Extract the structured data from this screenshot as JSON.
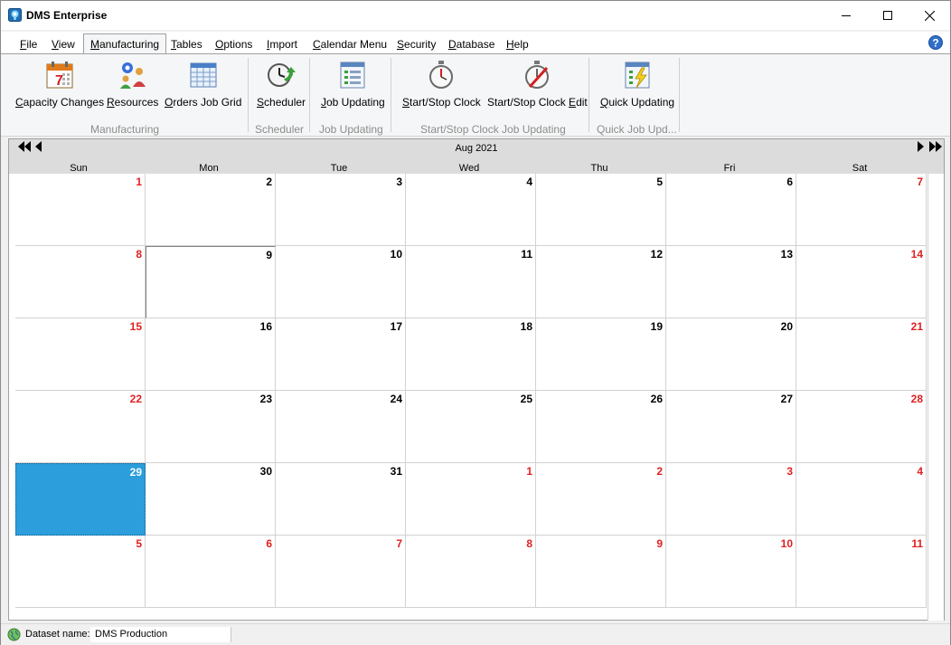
{
  "window": {
    "title": "DMS Enterprise"
  },
  "menu": [
    {
      "label": "File",
      "key": "F",
      "rest": "ile"
    },
    {
      "label": "View",
      "key": "V",
      "rest": "iew"
    },
    {
      "label": "Manufacturing",
      "key": "M",
      "rest": "anufacturing"
    },
    {
      "label": "Tables",
      "key": "T",
      "rest": "ables"
    },
    {
      "label": "Options",
      "key": "O",
      "rest": "ptions"
    },
    {
      "label": "Import",
      "key": "I",
      "rest": "mport"
    },
    {
      "label": "Calendar Menu",
      "key": "C",
      "rest": "alendar Menu"
    },
    {
      "label": "Security",
      "key": "S",
      "rest": "ecurity"
    },
    {
      "label": "Database",
      "key": "D",
      "rest": "atabase"
    },
    {
      "label": "Help",
      "key": "H",
      "rest": "elp"
    }
  ],
  "ribbon": {
    "buttons": [
      {
        "key": "C",
        "rest": "apacity Changes"
      },
      {
        "key": "R",
        "rest": "esources"
      },
      {
        "key": "O",
        "rest": "rders Job Grid"
      },
      {
        "key": "S",
        "rest": "cheduler"
      },
      {
        "key": "J",
        "rest": "ob Updating"
      },
      {
        "key": "S",
        "rest": "tart/Stop Clock"
      },
      {
        "pre": "Start/Stop Clock ",
        "key": "E",
        "rest": "dit"
      },
      {
        "key": "Q",
        "rest": "uick Updating"
      }
    ],
    "groups": [
      "Manufacturing",
      "Scheduler",
      "Job Updating",
      "Start/Stop Clock Job Updating",
      "Quick Job Upd..."
    ]
  },
  "calendar": {
    "month_title": "Aug 2021",
    "weekdays": [
      "Sun",
      "Mon",
      "Tue",
      "Wed",
      "Thu",
      "Fri",
      "Sat"
    ],
    "weeks": [
      [
        "1",
        "2",
        "3",
        "4",
        "5",
        "6",
        "7"
      ],
      [
        "8",
        "9",
        "10",
        "11",
        "12",
        "13",
        "14"
      ],
      [
        "15",
        "16",
        "17",
        "18",
        "19",
        "20",
        "21"
      ],
      [
        "22",
        "23",
        "24",
        "25",
        "26",
        "27",
        "28"
      ],
      [
        "29",
        "30",
        "31",
        "1",
        "2",
        "3",
        "4"
      ],
      [
        "5",
        "6",
        "7",
        "8",
        "9",
        "10",
        "11"
      ]
    ],
    "selected_date": "29",
    "today_date": "9"
  },
  "status": {
    "label": "Dataset name:",
    "value": "DMS Production"
  },
  "colors": {
    "selected": "#2b9edb",
    "weekend": "#e02020"
  }
}
